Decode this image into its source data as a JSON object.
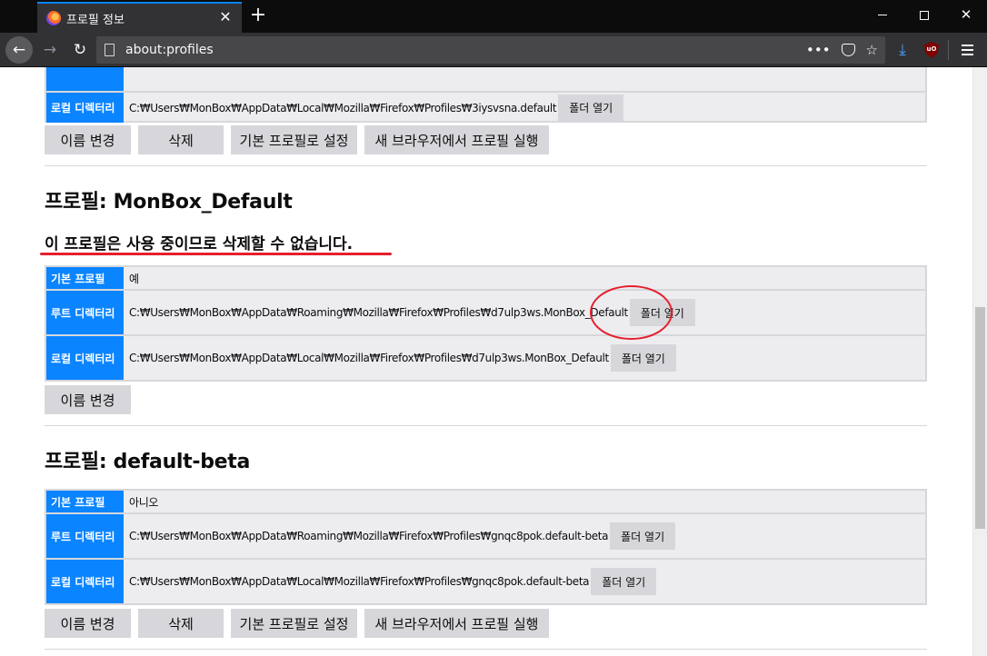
{
  "tab": {
    "title": "프로필 정보"
  },
  "url": "about:profiles",
  "button_labels": {
    "rename": "이름 변경",
    "delete": "삭제",
    "set_default": "기본 프로필로 설정",
    "launch": "새 브라우저에서 프로필 실행",
    "open_folder": "폴더 열기"
  },
  "field_labels": {
    "default_profile": "기본 프로필",
    "root_dir": "루트 디렉터리",
    "local_dir": "로컬 디렉터리"
  },
  "profiles": [
    {
      "local_dir": "C:₩Users₩MonBox₩AppData₩Local₩Mozilla₩Firefox₩Profiles₩3iysvsna.default"
    },
    {
      "title": "프로필: MonBox_Default",
      "warning": "이 프로필은 사용 중이므로 삭제할 수 없습니다.",
      "is_default": "예",
      "root_dir": "C:₩Users₩MonBox₩AppData₩Roaming₩Mozilla₩Firefox₩Profiles₩d7ulp3ws.MonBox_Default",
      "local_dir": "C:₩Users₩MonBox₩AppData₩Local₩Mozilla₩Firefox₩Profiles₩d7ulp3ws.MonBox_Default"
    },
    {
      "title": "프로필: default-beta",
      "is_default": "아니오",
      "root_dir": "C:₩Users₩MonBox₩AppData₩Roaming₩Mozilla₩Firefox₩Profiles₩gnqc8pok.default-beta",
      "local_dir": "C:₩Users₩MonBox₩AppData₩Local₩Mozilla₩Firefox₩Profiles₩gnqc8pok.default-beta"
    }
  ],
  "colors": {
    "label_bg": "#0a84ff",
    "annotation_red": "#e5202e",
    "toolbar_bg": "#323234",
    "titlebar_bg": "#0c0c0d"
  },
  "icons": [
    "firefox-favicon",
    "close-icon",
    "plus-icon",
    "back-arrow-icon",
    "forward-arrow-icon",
    "reload-icon",
    "page-icon",
    "more-actions-icon",
    "pocket-icon",
    "bookmark-star-icon",
    "download-icon",
    "ublock-icon",
    "hamburger-menu-icon"
  ]
}
